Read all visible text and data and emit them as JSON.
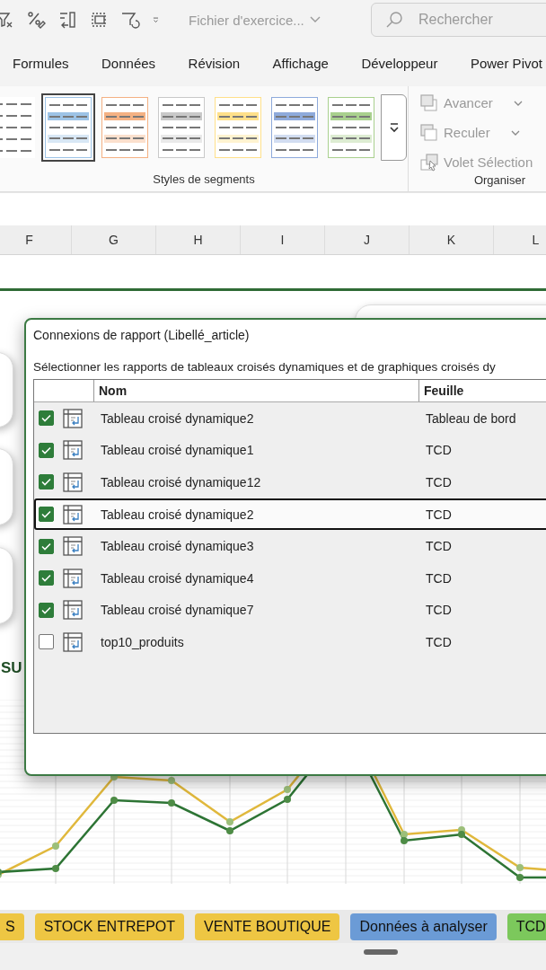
{
  "quick_access": {
    "document_title": "Fichier d'exercice...",
    "search": {
      "placeholder": "Rechercher"
    }
  },
  "ribbon_tabs": [
    {
      "label": "Formules"
    },
    {
      "label": "Données"
    },
    {
      "label": "Révision"
    },
    {
      "label": "Affichage"
    },
    {
      "label": "Développeur"
    },
    {
      "label": "Power Pivot"
    }
  ],
  "slicer_styles": {
    "label": "Styles de segments",
    "swatches": [
      {
        "kind": "plain",
        "selected": false
      },
      {
        "kind": "colored",
        "color": "#9dc3e6",
        "selected": true
      },
      {
        "kind": "colored",
        "color": "#f4b183",
        "selected": false
      },
      {
        "kind": "colored",
        "color": "#c9c9c9",
        "selected": false
      },
      {
        "kind": "colored",
        "color": "#ffe08a",
        "selected": false
      },
      {
        "kind": "colored",
        "color": "#8eaadb",
        "selected": false
      },
      {
        "kind": "colored",
        "color": "#a9d08e",
        "selected": false
      }
    ]
  },
  "arrange": {
    "label": "Organiser",
    "commands": [
      {
        "kind": "forward",
        "label": "Avancer",
        "has_menu": true,
        "disabled": true
      },
      {
        "kind": "backward",
        "label": "Reculer",
        "has_menu": true,
        "disabled": true
      },
      {
        "kind": "selection",
        "label": "Volet Sélection",
        "has_menu": false,
        "disabled": true
      }
    ]
  },
  "columns": [
    "F",
    "G",
    "H",
    "I",
    "J",
    "K",
    "L"
  ],
  "dashboard": {
    "heading_fragment": "SU"
  },
  "dialog": {
    "title": "Connexions de rapport (Libellé_article)",
    "instruction": "Sélectionner les rapports de tableaux croisés dynamiques et de graphiques croisés dy",
    "columns": [
      "Nom",
      "Feuille"
    ],
    "rows": [
      {
        "name": "Tableau croisé dynamique2",
        "sheet": "Tableau de bord",
        "checked": true,
        "selected": false
      },
      {
        "name": "Tableau croisé dynamique1",
        "sheet": "TCD",
        "checked": true,
        "selected": false
      },
      {
        "name": "Tableau croisé dynamique12",
        "sheet": "TCD",
        "checked": true,
        "selected": false
      },
      {
        "name": "Tableau croisé dynamique2",
        "sheet": "TCD",
        "checked": true,
        "selected": true
      },
      {
        "name": "Tableau croisé dynamique3",
        "sheet": "TCD",
        "checked": true,
        "selected": false
      },
      {
        "name": "Tableau croisé dynamique4",
        "sheet": "TCD",
        "checked": true,
        "selected": false
      },
      {
        "name": "Tableau croisé dynamique7",
        "sheet": "TCD",
        "checked": true,
        "selected": false
      },
      {
        "name": "top10_produits",
        "sheet": "TCD",
        "checked": false,
        "selected": false
      }
    ]
  },
  "sheet_tabs": [
    {
      "label": "S",
      "color": "#eec643"
    },
    {
      "label": "STOCK ENTREPOT",
      "color": "#eec643"
    },
    {
      "label": "VENTE BOUTIQUE",
      "color": "#eec643"
    },
    {
      "label": "Données à analyser",
      "color": "#6b9bd6"
    },
    {
      "label": "TCD",
      "color": "#7cc85c"
    }
  ]
}
